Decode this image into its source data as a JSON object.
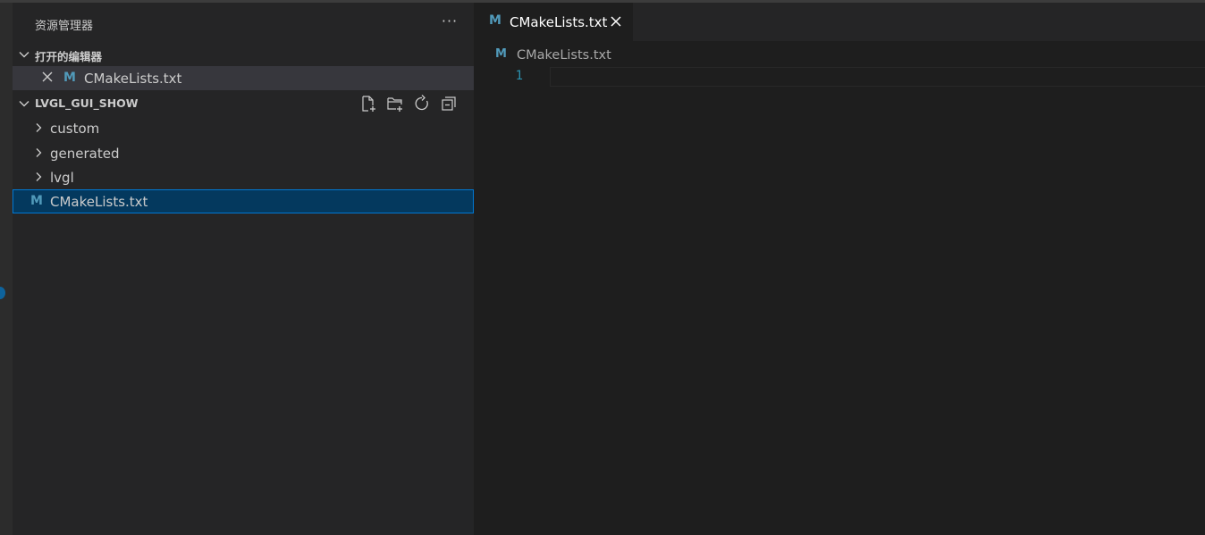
{
  "sidebar": {
    "title": "资源管理器",
    "more_label": "···",
    "open_editors": {
      "label": "打开的编辑器",
      "items": [
        {
          "name": "CMakeLists.txt",
          "icon": "m-file-icon"
        }
      ]
    },
    "workspace": {
      "label": "LVGL_GUI_SHOW",
      "actions": [
        "new-file-icon",
        "new-folder-icon",
        "refresh-icon",
        "collapse-all-icon"
      ],
      "folders": [
        "custom",
        "generated",
        "lvgl"
      ],
      "files": [
        {
          "name": "CMakeLists.txt",
          "icon": "m-file-icon",
          "selected": true
        }
      ]
    }
  },
  "editor": {
    "tab": {
      "label": "CMakeLists.txt",
      "icon": "m-file-icon"
    },
    "breadcrumb": "CMakeLists.txt",
    "line_numbers": [
      "1"
    ]
  },
  "icons": {
    "m_glyph": "M"
  },
  "colors": {
    "accent": "#0078d4",
    "selection": "#04395e",
    "file_icon": "#519aba",
    "line_number": "#2b91af"
  }
}
